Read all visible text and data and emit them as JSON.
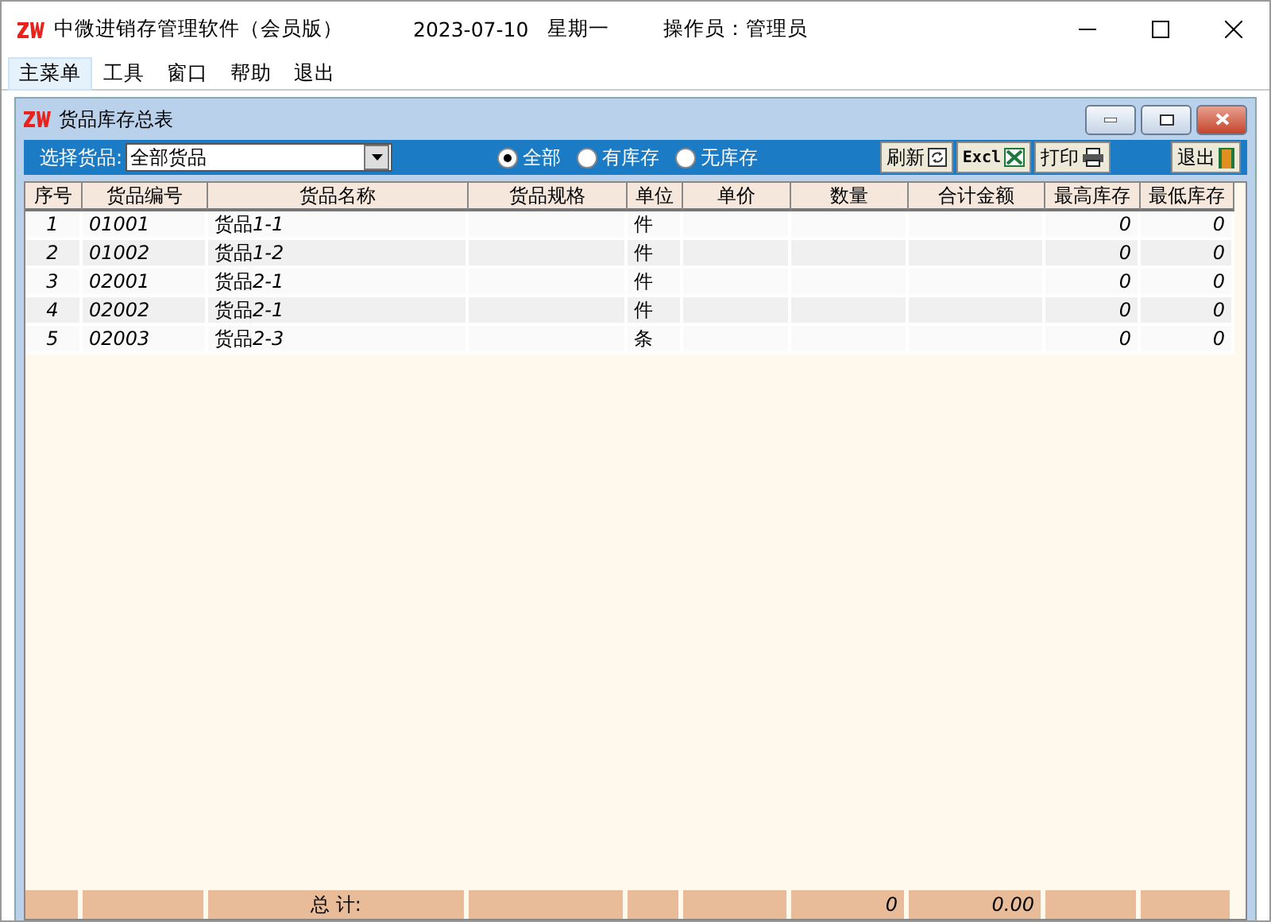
{
  "window": {
    "title": "中微进销存管理软件（会员版）",
    "date": "2023-07-10",
    "weekday": "星期一",
    "operator": "操作员：管理员"
  },
  "menu": [
    {
      "label": "主菜单",
      "selected": true
    },
    {
      "label": "工具",
      "selected": false
    },
    {
      "label": "窗口",
      "selected": false
    },
    {
      "label": "帮助",
      "selected": false
    },
    {
      "label": "退出",
      "selected": false
    }
  ],
  "child_window": {
    "title": "货品库存总表"
  },
  "toolbar": {
    "filter_label": "选择货品:",
    "filter_value": "全部货品",
    "radios": [
      {
        "label": "全部",
        "selected": true
      },
      {
        "label": "有库存",
        "selected": false
      },
      {
        "label": "无库存",
        "selected": false
      }
    ],
    "buttons": [
      {
        "label": "刷新",
        "kind": "refresh"
      },
      {
        "label": "Excl",
        "kind": "excel"
      },
      {
        "label": "打印",
        "kind": "print"
      }
    ],
    "exit_button": "退出"
  },
  "table": {
    "columns": [
      "序号",
      "货品编号",
      "货品名称",
      "货品规格",
      "单位",
      "单价",
      "数量",
      "合计金额",
      "最高库存",
      "最低库存"
    ],
    "rows": [
      {
        "no": "1",
        "code": "01001",
        "name_prefix": "货品",
        "name_suffix": "1-1",
        "unit": "件",
        "max_stock": "0",
        "min_stock": "0"
      },
      {
        "no": "2",
        "code": "01002",
        "name_prefix": "货品",
        "name_suffix": "1-2",
        "unit": "件",
        "max_stock": "0",
        "min_stock": "0"
      },
      {
        "no": "3",
        "code": "02001",
        "name_prefix": "货品",
        "name_suffix": "2-1",
        "unit": "件",
        "max_stock": "0",
        "min_stock": "0"
      },
      {
        "no": "4",
        "code": "02002",
        "name_prefix": "货品",
        "name_suffix": "2-1",
        "unit": "件",
        "max_stock": "0",
        "min_stock": "0"
      },
      {
        "no": "5",
        "code": "02003",
        "name_prefix": "货品",
        "name_suffix": "2-3",
        "unit": "条",
        "max_stock": "0",
        "min_stock": "0"
      }
    ],
    "footer": {
      "label": "总 计:",
      "quantity": "0",
      "amount": "0.00"
    }
  }
}
